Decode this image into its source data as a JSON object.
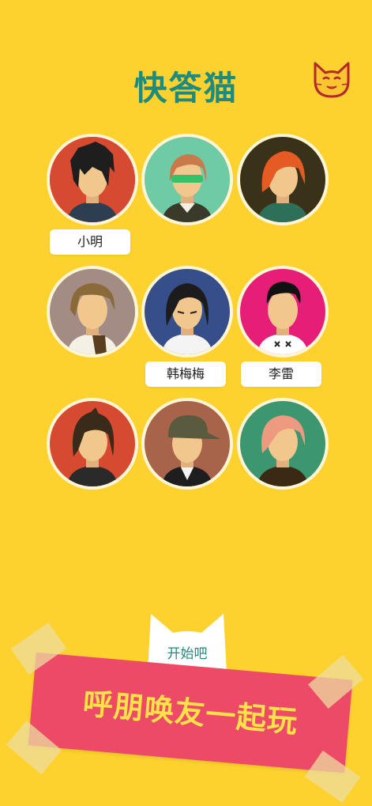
{
  "header": {
    "title": "快答猫",
    "cat_icon": "cat-face-icon"
  },
  "players": [
    {
      "name": "小明",
      "avatar": "spiky-black-hair-boy"
    },
    {
      "name": "",
      "avatar": "green-sunglasses-guy"
    },
    {
      "name": "",
      "avatar": "orange-hair-girl"
    },
    {
      "name": "",
      "avatar": "brown-hair-guy"
    },
    {
      "name": "韩梅梅",
      "avatar": "black-hair-glasses-girl"
    },
    {
      "name": "李雷",
      "avatar": "black-hair-boy"
    },
    {
      "name": "",
      "avatar": "dark-hair-girl"
    },
    {
      "name": "",
      "avatar": "cap-guy"
    },
    {
      "name": "",
      "avatar": "pink-hair-girl"
    }
  ],
  "start": {
    "label": "开始吧"
  },
  "banner": {
    "text": "呼朋唤友一起玩"
  },
  "colors": {
    "background": "#FDD22E",
    "accent": "#1E8B7C",
    "banner": "#EC4A66",
    "banner_text": "#FFE14A"
  }
}
